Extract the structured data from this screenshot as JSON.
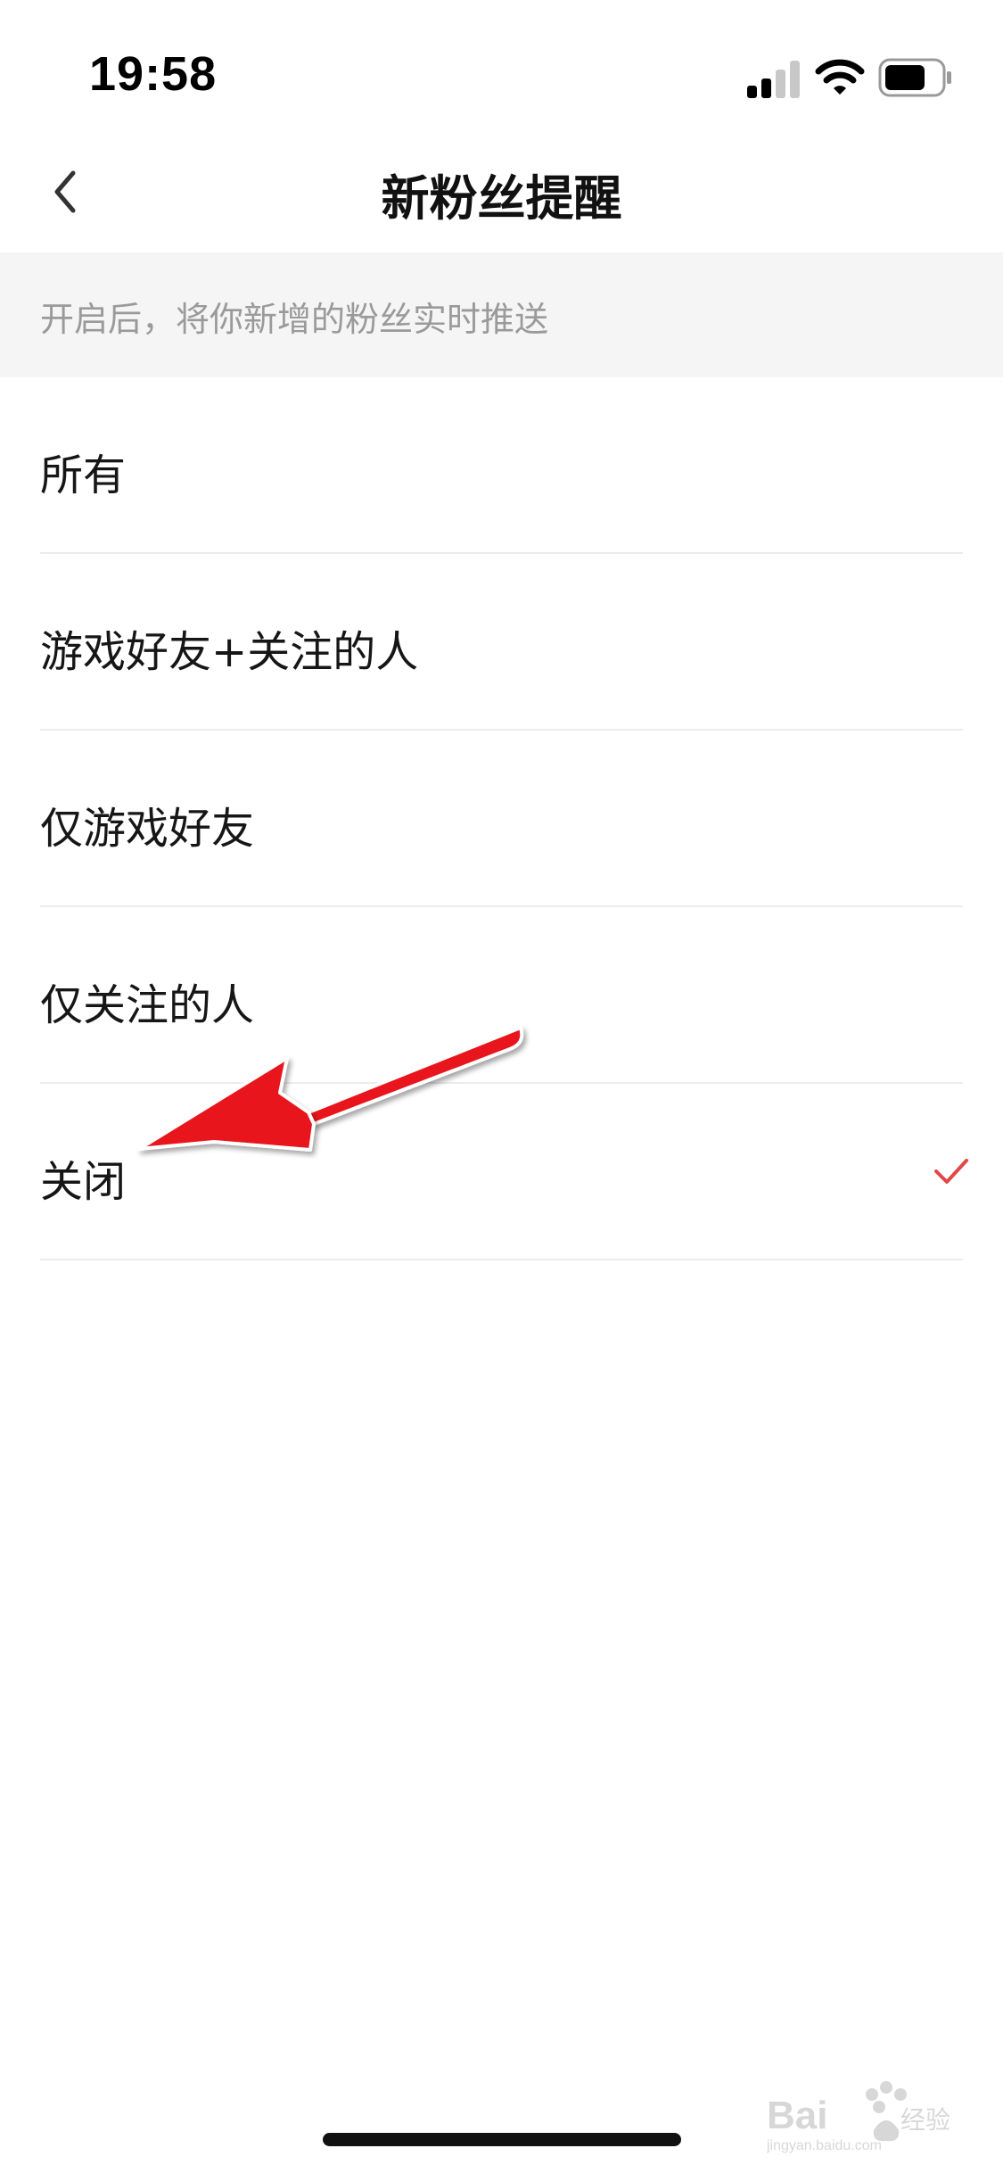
{
  "status_bar": {
    "time": "19:58",
    "icons": [
      "signal-icon",
      "wifi-icon",
      "battery-icon"
    ]
  },
  "nav": {
    "back_icon": "chevron-left-icon",
    "title": "新粉丝提醒"
  },
  "hint": {
    "text": "开启后，将你新增的粉丝实时推送"
  },
  "options": [
    {
      "label": "所有",
      "selected": false
    },
    {
      "label": "游戏好友+关注的人",
      "selected": false
    },
    {
      "label": "仅游戏好友",
      "selected": false
    },
    {
      "label": "仅关注的人",
      "selected": false
    },
    {
      "label": "关闭",
      "selected": true
    }
  ],
  "colors": {
    "check": "#e04848",
    "hint_bg": "#f5f5f5",
    "hint_text": "#9a9a9a",
    "arrow": "#e8141a"
  },
  "watermark": {
    "brand": "Baidu经验",
    "domain": "jingyan.baidu.com"
  }
}
